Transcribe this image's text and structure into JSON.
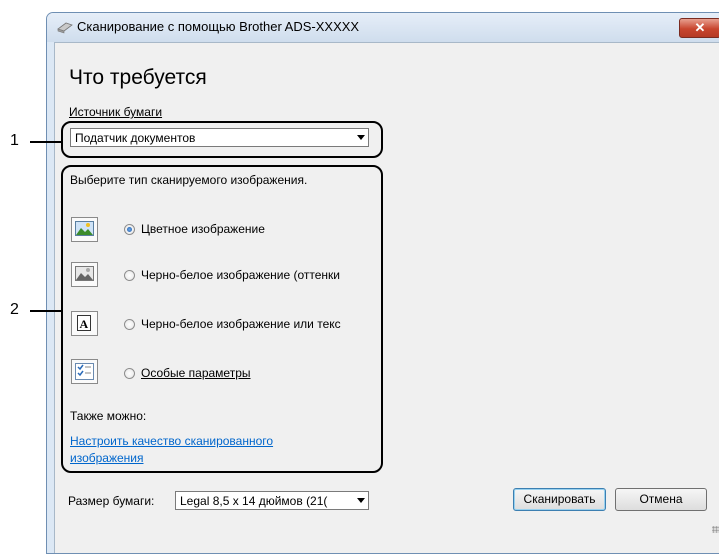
{
  "window": {
    "title": "Сканирование с помощью Brother ADS-XXXXX",
    "close_label": "✕"
  },
  "heading": "Что требуется",
  "paper_source": {
    "label": "Источник бумаги",
    "selected": "Податчик документов"
  },
  "image_type": {
    "prompt": "Выберите тип сканируемого изображения.",
    "options": [
      {
        "label": "Цветное изображение",
        "selected": true,
        "icon": "color-picture-icon"
      },
      {
        "label": "Черно-белое изображение (оттенки",
        "selected": false,
        "icon": "grayscale-picture-icon"
      },
      {
        "label": "Черно-белое изображение или текс",
        "selected": false,
        "icon": "bw-text-icon"
      },
      {
        "label": "Особые параметры",
        "selected": false,
        "icon": "custom-settings-icon"
      }
    ]
  },
  "also": {
    "label": "Также можно:",
    "link_line1": "Настроить качество сканированного",
    "link_line2": "изображения"
  },
  "paper_size": {
    "label": "Размер бумаги:",
    "selected": "Legal 8,5 x 14 дюймов (21("
  },
  "buttons": {
    "scan": "Сканировать",
    "cancel": "Отмена"
  },
  "callouts": {
    "one": "1",
    "two": "2"
  },
  "colors": {
    "link": "#0066cc",
    "close_button": "#c8452e",
    "window_border": "#6f8fb3"
  }
}
